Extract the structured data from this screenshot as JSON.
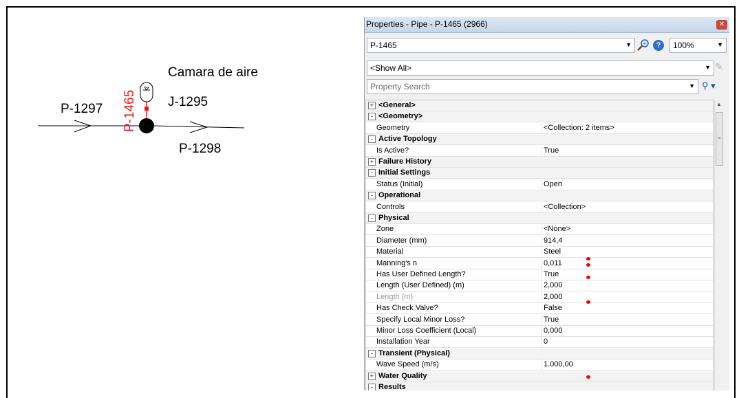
{
  "drawing": {
    "label_camara": "Camara de aire",
    "label_p1297": "P-1297",
    "label_p1465": "P-1465",
    "label_j1295": "J-1295",
    "label_p1298": "P-1298"
  },
  "panel": {
    "title": "Properties - Pipe - P-1465 (2966)",
    "element_combo": "P-1465",
    "zoom": "100%",
    "filter": "<Show All>",
    "search_placeholder": "Property Search",
    "rows": [
      {
        "type": "cat",
        "exp": "+",
        "label": "<General>"
      },
      {
        "type": "cat",
        "exp": "-",
        "label": "<Geometry>"
      },
      {
        "type": "prop",
        "label": "Geometry",
        "value": "<Collection: 2 items>"
      },
      {
        "type": "cat",
        "exp": "-",
        "label": "Active Topology"
      },
      {
        "type": "prop",
        "label": "Is Active?",
        "value": "True"
      },
      {
        "type": "cat",
        "exp": "+",
        "label": "Failure History"
      },
      {
        "type": "cat",
        "exp": "-",
        "label": "Initial Settings"
      },
      {
        "type": "prop",
        "label": "Status (Initial)",
        "value": "Open"
      },
      {
        "type": "cat",
        "exp": "-",
        "label": "Operational"
      },
      {
        "type": "prop",
        "label": "Controls",
        "value": "<Collection>"
      },
      {
        "type": "cat",
        "exp": "-",
        "label": "Physical"
      },
      {
        "type": "prop",
        "label": "Zone",
        "value": "<None>"
      },
      {
        "type": "prop",
        "label": "Diameter (mm)",
        "value": "914,4"
      },
      {
        "type": "prop",
        "label": "Material",
        "value": "Steel"
      },
      {
        "type": "prop",
        "label": "Manning's n",
        "value": "0,011"
      },
      {
        "type": "prop",
        "label": "Has User Defined Length?",
        "value": "True"
      },
      {
        "type": "prop",
        "label": "Length (User Defined) (m)",
        "value": "2,000"
      },
      {
        "type": "prop",
        "label": "Length (m)",
        "value": "2,000",
        "disabled": true
      },
      {
        "type": "prop",
        "label": "Has Check Valve?",
        "value": "False"
      },
      {
        "type": "prop",
        "label": "Specify Local Minor Loss?",
        "value": "True"
      },
      {
        "type": "prop",
        "label": "Minor Loss Coefficient (Local)",
        "value": "0,000"
      },
      {
        "type": "prop",
        "label": "Installation Year",
        "value": "0"
      },
      {
        "type": "cat",
        "exp": "-",
        "label": "Transient (Physical)"
      },
      {
        "type": "prop",
        "label": "Wave Speed (m/s)",
        "value": "1.000,00"
      },
      {
        "type": "cat",
        "exp": "+",
        "label": "Water Quality"
      },
      {
        "type": "cat",
        "exp": "-",
        "label": "Results"
      }
    ]
  },
  "colors": {
    "pipe_label_red": "#e21b1b",
    "marker_red": "#e00000",
    "title_gradient": "#c5d6ea"
  },
  "icons": [
    "close-icon",
    "zoom-icon",
    "help-icon",
    "dropdown-arrow-icon",
    "edit-icon",
    "search-icon",
    "scroll-up-icon"
  ]
}
